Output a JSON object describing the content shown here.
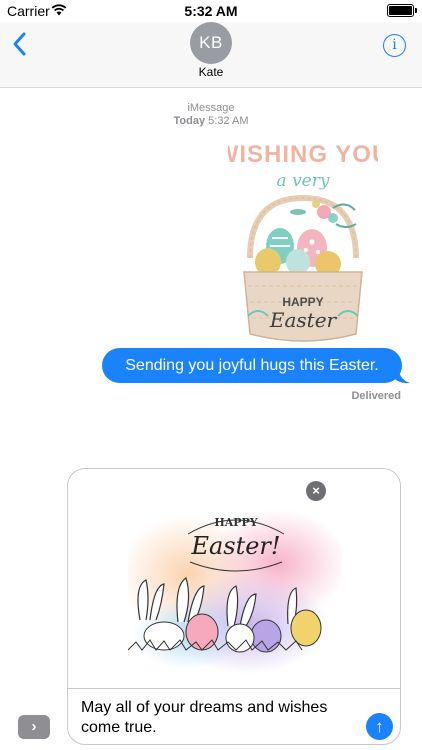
{
  "status_bar": {
    "carrier": "Carrier",
    "time": "5:32 AM",
    "battery_level": 1.0
  },
  "header": {
    "avatar_initials": "KB",
    "contact_name": "Kate"
  },
  "thread": {
    "service": "iMessage",
    "timestamp_day": "Today",
    "timestamp_time": "5:32 AM",
    "sticker_1": {
      "line1": "WISHING YOU",
      "line2": "a very",
      "line3": "HAPPY",
      "line4": "Easter"
    },
    "sent_message": "Sending you joyful hugs this Easter.",
    "delivery_status": "Delivered"
  },
  "compose": {
    "sticker_2": {
      "line1": "HAPPY",
      "line2": "Easter!"
    },
    "draft_text": "May all of your dreams and wishes come true."
  },
  "colors": {
    "accent": "#1a82fb",
    "bubble_text": "#ffffff",
    "meta": "#8e8e93"
  },
  "icons": {
    "back": "chevron-left-icon",
    "info": "info-icon",
    "remove": "close-icon",
    "send": "arrow-up-icon",
    "expand": "chevron-right-icon"
  }
}
